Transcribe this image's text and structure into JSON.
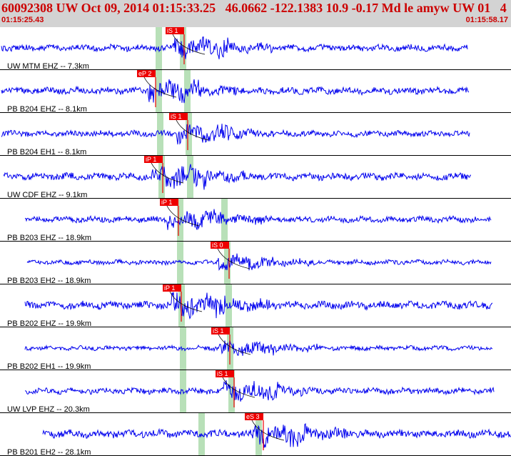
{
  "header": {
    "title": "60092308 UW Oct 09, 2014 01:15:33.25   46.0662 -122.1383 10.9 -0.17 Md le amyw UW 01   4",
    "start_time": "01:15:25.43",
    "end_time": "01:15:58.17"
  },
  "colors": {
    "trace": "#0000ee",
    "pick": "#ee0000",
    "window": "#b8e0b8",
    "background": "#ffffff",
    "header_bg": "#d3d3d3"
  },
  "traces": [
    {
      "label": "UW MTM EHZ -- 7.3km",
      "pick": "iS 1",
      "amp": 0.35
    },
    {
      "label": "PB B204 EHZ -- 8.1km",
      "pick": "eP 2",
      "amp": 0.4
    },
    {
      "label": "PB B204 EH1 -- 8.1km",
      "pick": "iS 1",
      "amp": 0.3
    },
    {
      "label": "UW CDF EHZ -- 9.1km",
      "pick": "iP 1",
      "amp": 0.45
    },
    {
      "label": "PB B203 EHZ -- 18.9km",
      "pick": "iP 1",
      "amp": 0.3
    },
    {
      "label": "PB B203 EH2 -- 18.9km",
      "pick": "iS 0",
      "amp": 0.15
    },
    {
      "label": "PB B202 EHZ -- 19.9km",
      "pick": "iP 1",
      "amp": 0.5
    },
    {
      "label": "PB B202 EH1 -- 19.9km",
      "pick": "iS 1",
      "amp": 0.15
    },
    {
      "label": "UW LVP EHZ -- 20.3km",
      "pick": "iS 1",
      "amp": 0.3
    },
    {
      "label": "PB B201 EH2 -- 28.1km",
      "pick": "eS 3",
      "amp": 0.5
    }
  ]
}
